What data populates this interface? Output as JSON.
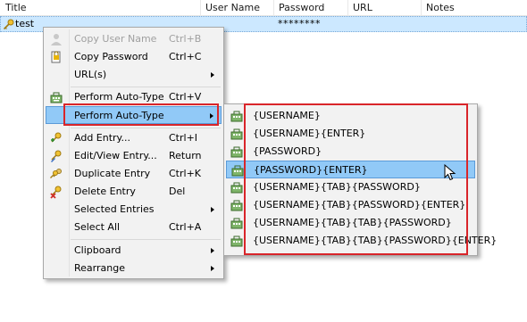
{
  "columns": {
    "title": "Title",
    "username": "User Name",
    "password": "Password",
    "url": "URL",
    "notes": "Notes"
  },
  "entry": {
    "title": "test",
    "password": "********",
    "icon": "key-icon"
  },
  "context_menu": {
    "items": [
      {
        "label": "Copy User Name",
        "shortcut": "Ctrl+B",
        "icon": "copy-user-icon",
        "disabled": true
      },
      {
        "label": "Copy Password",
        "shortcut": "Ctrl+C",
        "icon": "copy-password-icon"
      },
      {
        "label": "URL(s)",
        "submenu": true
      },
      {
        "label": "Perform Auto-Type",
        "shortcut": "Ctrl+V",
        "icon": "auto-type-icon"
      },
      {
        "label": "Perform Auto-Type",
        "submenu": true,
        "highlighted": true
      },
      {
        "label": "Add Entry...",
        "shortcut": "Ctrl+I",
        "icon": "add-entry-icon"
      },
      {
        "label": "Edit/View Entry...",
        "shortcut": "Return",
        "icon": "edit-entry-icon"
      },
      {
        "label": "Duplicate Entry",
        "shortcut": "Ctrl+K",
        "icon": "duplicate-entry-icon"
      },
      {
        "label": "Delete Entry",
        "shortcut": "Del",
        "icon": "delete-entry-icon"
      },
      {
        "label": "Selected Entries",
        "submenu": true
      },
      {
        "label": "Select All",
        "shortcut": "Ctrl+A"
      },
      {
        "label": "Clipboard",
        "submenu": true
      },
      {
        "label": "Rearrange",
        "submenu": true
      }
    ]
  },
  "auto_type_submenu": {
    "items": [
      "{USERNAME}",
      "{USERNAME}{ENTER}",
      "{PASSWORD}",
      "{PASSWORD}{ENTER}",
      "{USERNAME}{TAB}{PASSWORD}",
      "{USERNAME}{TAB}{PASSWORD}{ENTER}",
      "{USERNAME}{TAB}{TAB}{PASSWORD}",
      "{USERNAME}{TAB}{TAB}{PASSWORD}{ENTER}"
    ],
    "highlighted_index": 3
  },
  "colors": {
    "highlight": "#91c9f7",
    "selected_row": "#cce8ff",
    "callout": "#d9252a"
  }
}
